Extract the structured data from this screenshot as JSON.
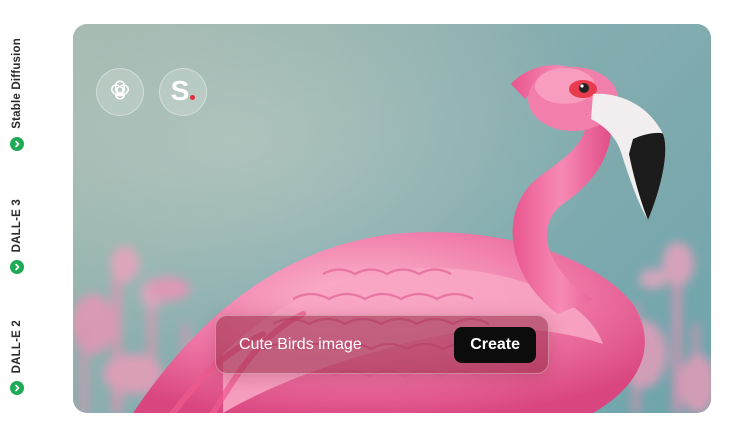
{
  "sidebar": {
    "models": [
      {
        "label": "Stable Diffusion",
        "icon": "chevron-right-icon"
      },
      {
        "label": "DALL-E 3",
        "icon": "chevron-right-icon"
      },
      {
        "label": "DALL-E 2",
        "icon": "chevron-right-icon"
      }
    ]
  },
  "hero": {
    "image_subject": "flamingo",
    "providers": [
      {
        "icon": "openai-logo-icon"
      },
      {
        "icon": "s-logo-icon",
        "text": "S"
      }
    ]
  },
  "prompt": {
    "value": "Cute Birds image",
    "button_label": "Create"
  },
  "colors": {
    "accent_green": "#1faa55",
    "button_black": "#0c0c0c",
    "flamingo_pink": "#f07aa8",
    "background_teal": "#7eaaae"
  }
}
